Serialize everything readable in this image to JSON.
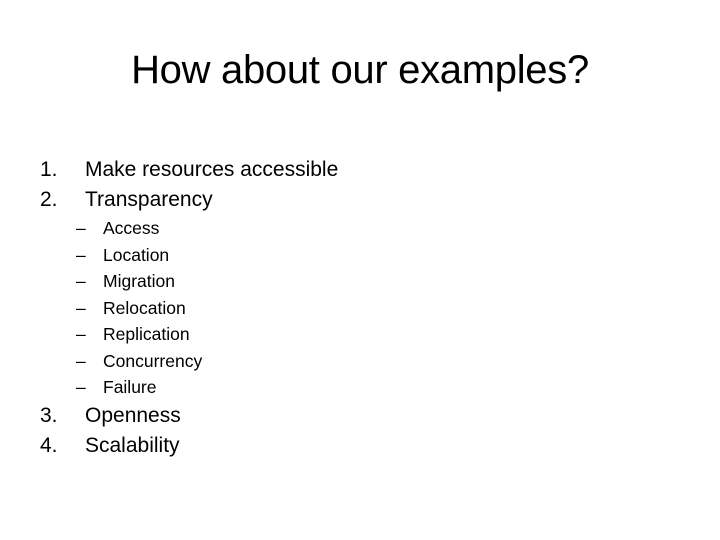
{
  "slide": {
    "title": "How about our examples?",
    "items": [
      {
        "number": "1.",
        "label": "Make resources accessible"
      },
      {
        "number": "2.",
        "label": "Transparency"
      },
      {
        "number": "3.",
        "label": "Openness"
      },
      {
        "number": "4.",
        "label": "Scalability"
      }
    ],
    "transparency_subitems": [
      {
        "bullet": "–",
        "label": "Access"
      },
      {
        "bullet": "–",
        "label": "Location"
      },
      {
        "bullet": "–",
        "label": "Migration"
      },
      {
        "bullet": "–",
        "label": "Relocation"
      },
      {
        "bullet": "–",
        "label": "Replication"
      },
      {
        "bullet": "–",
        "label": "Concurrency"
      },
      {
        "bullet": "–",
        "label": "Failure"
      }
    ]
  }
}
